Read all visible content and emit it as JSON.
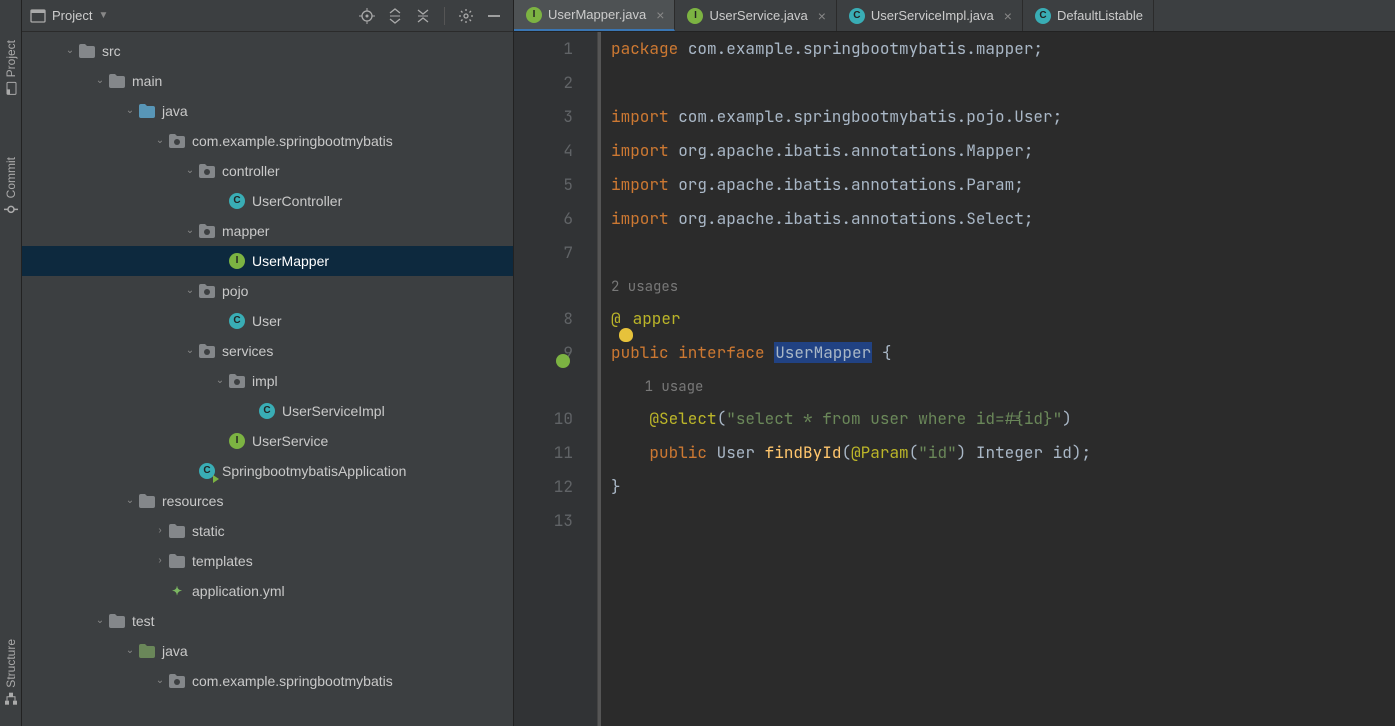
{
  "rail_top": [
    "Project"
  ],
  "rail_mid": [
    "Commit"
  ],
  "rail_bottom": [
    "Structure"
  ],
  "panel": {
    "title": "Project"
  },
  "tree": [
    {
      "d": 0,
      "exp": true,
      "kind": "dir",
      "name": "src"
    },
    {
      "d": 1,
      "exp": true,
      "kind": "dir",
      "name": "main"
    },
    {
      "d": 2,
      "exp": true,
      "kind": "src",
      "name": "java"
    },
    {
      "d": 3,
      "exp": true,
      "kind": "pkg",
      "name": "com.example.springbootmybatis"
    },
    {
      "d": 4,
      "exp": true,
      "kind": "pkg",
      "name": "controller"
    },
    {
      "d": 5,
      "exp": false,
      "kind": "cls",
      "name": "UserController"
    },
    {
      "d": 4,
      "exp": true,
      "kind": "pkg",
      "name": "mapper"
    },
    {
      "d": 5,
      "exp": false,
      "kind": "int",
      "name": "UserMapper",
      "sel": true
    },
    {
      "d": 4,
      "exp": true,
      "kind": "pkg",
      "name": "pojo"
    },
    {
      "d": 5,
      "exp": false,
      "kind": "cls",
      "name": "User"
    },
    {
      "d": 4,
      "exp": true,
      "kind": "pkg",
      "name": "services"
    },
    {
      "d": 5,
      "exp": true,
      "kind": "pkg",
      "name": "impl"
    },
    {
      "d": 6,
      "exp": false,
      "kind": "cls",
      "name": "UserServiceImpl"
    },
    {
      "d": 5,
      "exp": false,
      "kind": "int",
      "name": "UserService"
    },
    {
      "d": 4,
      "exp": false,
      "kind": "run",
      "name": "SpringbootmybatisApplication"
    },
    {
      "d": 2,
      "exp": true,
      "kind": "res",
      "name": "resources"
    },
    {
      "d": 3,
      "exp": false,
      "kind": "dir",
      "name": "static"
    },
    {
      "d": 3,
      "exp": false,
      "kind": "dir",
      "name": "templates"
    },
    {
      "d": 3,
      "exp": false,
      "kind": "yml",
      "name": "application.yml"
    },
    {
      "d": 1,
      "exp": true,
      "kind": "dir",
      "name": "test"
    },
    {
      "d": 2,
      "exp": true,
      "kind": "tst",
      "name": "java"
    },
    {
      "d": 3,
      "exp": true,
      "kind": "pkg",
      "name": "com.example.springbootmybatis"
    }
  ],
  "tabs": [
    {
      "kind": "int",
      "name": "UserMapper.java",
      "act": true
    },
    {
      "kind": "int",
      "name": "UserService.java"
    },
    {
      "kind": "cls",
      "name": "UserServiceImpl.java"
    },
    {
      "kind": "cls",
      "name": "DefaultListable",
      "noclose": true
    }
  ],
  "code": {
    "usages_top": "2 usages",
    "usage_mid": "1 usage",
    "lines": [
      {
        "n": 1,
        "segs": [
          [
            "kw",
            "package "
          ],
          [
            "pkgn",
            "com.example.springbootmybatis.mapper"
          ],
          [
            "plain",
            ";"
          ]
        ]
      },
      {
        "n": 2,
        "segs": []
      },
      {
        "n": 3,
        "segs": [
          [
            "kw",
            "import "
          ],
          [
            "pkgn",
            "com.example.springbootmybatis.pojo."
          ],
          [
            "cls",
            "User"
          ],
          [
            "plain",
            ";"
          ]
        ]
      },
      {
        "n": 4,
        "segs": [
          [
            "kw",
            "import "
          ],
          [
            "pkgn",
            "org.apache.ibatis.annotations."
          ],
          [
            "cls",
            "Mapper"
          ],
          [
            "plain",
            ";"
          ]
        ]
      },
      {
        "n": 5,
        "segs": [
          [
            "kw",
            "import "
          ],
          [
            "pkgn",
            "org.apache.ibatis.annotations."
          ],
          [
            "cls",
            "Param"
          ],
          [
            "plain",
            ";"
          ]
        ]
      },
      {
        "n": 6,
        "segs": [
          [
            "kw",
            "import "
          ],
          [
            "pkgn",
            "org.apache.ibatis.annotations."
          ],
          [
            "cls",
            "Select"
          ],
          [
            "plain",
            ";"
          ]
        ]
      },
      {
        "n": 7,
        "segs": []
      },
      {
        "inlay": "usages_top"
      },
      {
        "n": 8,
        "bulb": true,
        "segs": [
          [
            "ann",
            "@Mapper"
          ]
        ]
      },
      {
        "n": 9,
        "green": true,
        "segs": [
          [
            "kw",
            "public interface "
          ],
          [
            "hl",
            "UserMapper"
          ],
          [
            "plain",
            " {"
          ]
        ]
      },
      {
        "inlay": "usage_mid",
        "indent": "    "
      },
      {
        "n": 10,
        "segs": [
          [
            "plain",
            "    "
          ],
          [
            "ann",
            "@Select"
          ],
          [
            "plain",
            "("
          ],
          [
            "str",
            "\"select * from user where id=#{id}\""
          ],
          [
            "plain",
            ")"
          ]
        ]
      },
      {
        "n": 11,
        "segs": [
          [
            "plain",
            "    "
          ],
          [
            "kw",
            "public "
          ],
          [
            "cls",
            "User "
          ],
          [
            "fn",
            "findById"
          ],
          [
            "plain",
            "("
          ],
          [
            "ann",
            "@Param"
          ],
          [
            "plain",
            "("
          ],
          [
            "str",
            "\"id\""
          ],
          [
            "plain",
            ") Integer id);"
          ]
        ]
      },
      {
        "n": 12,
        "segs": [
          [
            "plain",
            "}"
          ]
        ]
      },
      {
        "n": 13,
        "segs": []
      }
    ]
  }
}
